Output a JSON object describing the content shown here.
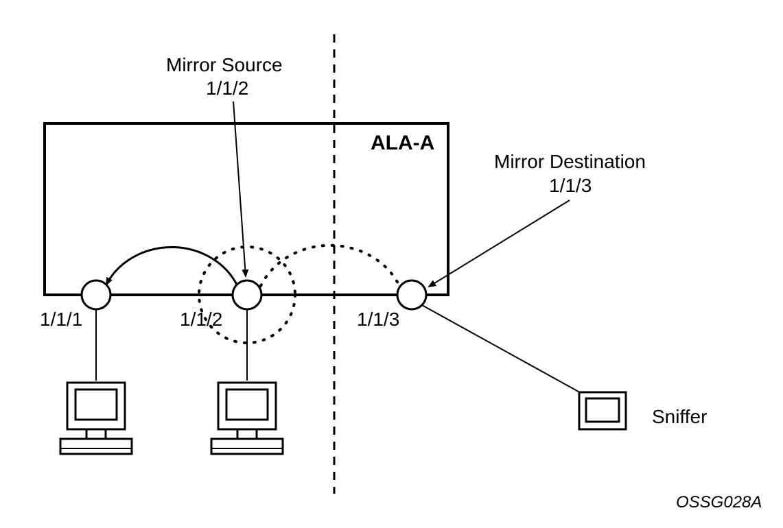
{
  "device": {
    "name": "ALA-A"
  },
  "ports": {
    "p1": "1/1/1",
    "p2": "1/1/2",
    "p3": "1/1/3"
  },
  "annotations": {
    "mirror_source_title": "Mirror Source",
    "mirror_source_port": "1/1/2",
    "mirror_dest_title": "Mirror Destination",
    "mirror_dest_port": "1/1/3",
    "sniffer": "Sniffer"
  },
  "figure_id": "OSSG028A"
}
